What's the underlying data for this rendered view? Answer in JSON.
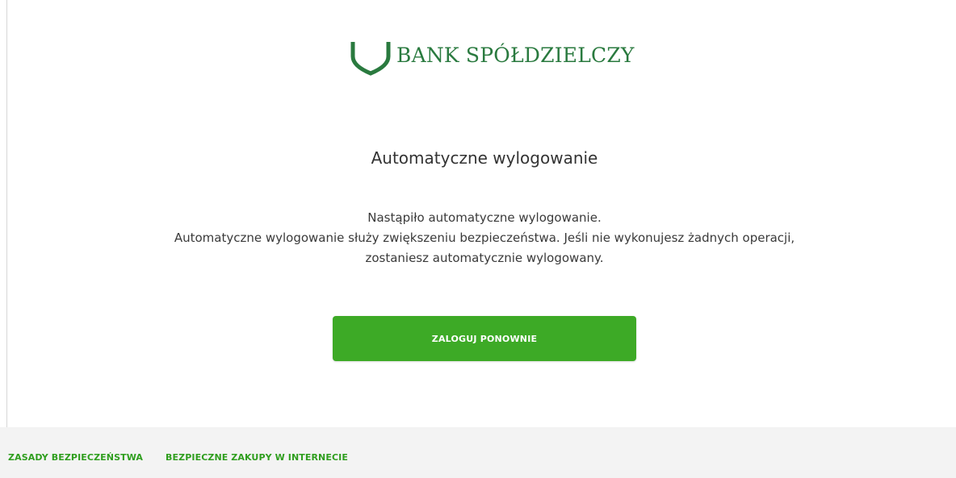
{
  "brand": {
    "name": "BANK SPÓŁDZIELCZY",
    "color": "#2a7a3f"
  },
  "main": {
    "title": "Automatyczne wylogowanie",
    "message_lines": [
      "Nastąpiło automatyczne wylogowanie.",
      "Automatyczne wylogowanie służy zwiększeniu bezpieczeństwa. Jeśli nie wykonujesz żadnych operacji,",
      "zostaniesz automatycznie wylogowany."
    ],
    "login_button_label": "ZALOGUJ PONOWNIE",
    "button_color": "#3daa26"
  },
  "footer": {
    "links": [
      "ZASADY BEZPIECZEŃSTWA",
      "BEZPIECZNE ZAKUPY W INTERNECIE"
    ],
    "link_color": "#2f9e1e"
  }
}
